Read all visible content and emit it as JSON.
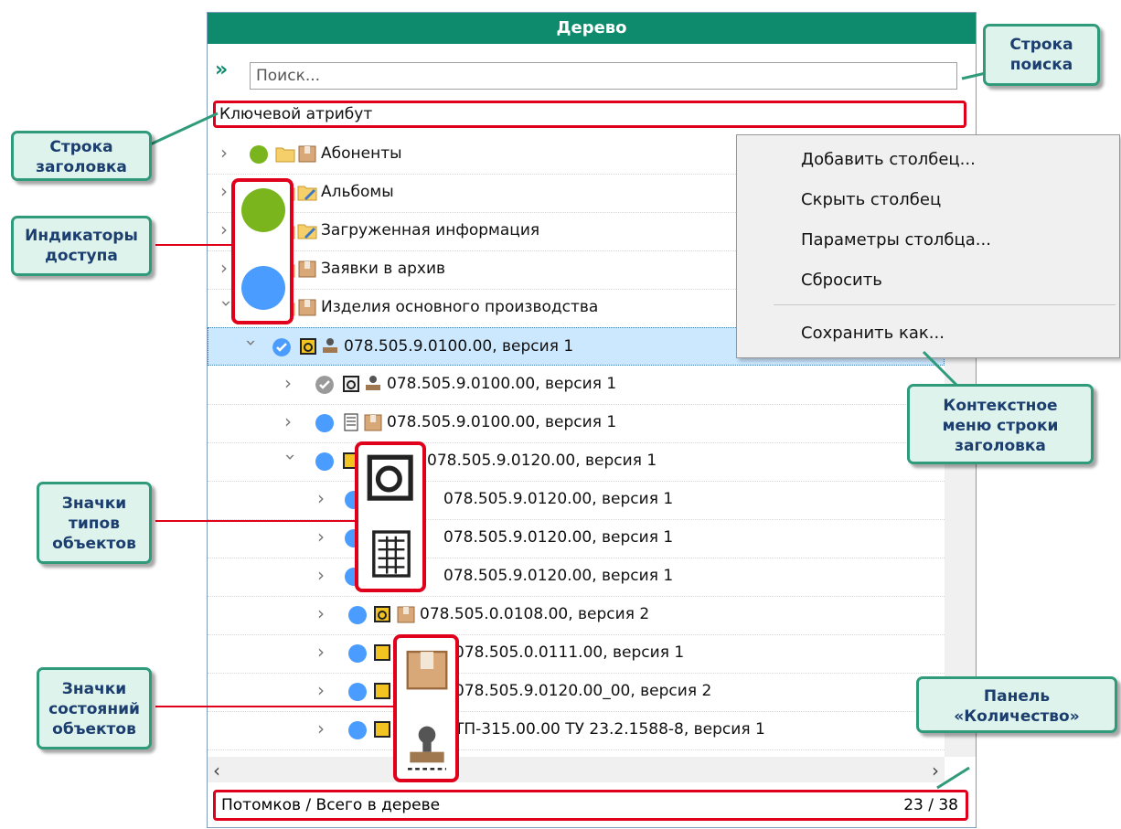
{
  "window": {
    "title": "Дерево"
  },
  "search": {
    "placeholder": "Поиск..."
  },
  "header_row": {
    "label": "Ключевой атрибут"
  },
  "tree": {
    "rows": [
      {
        "label": "Абоненты"
      },
      {
        "label": "Альбомы"
      },
      {
        "label": "Загруженная информация"
      },
      {
        "label": "Заявки в архив"
      },
      {
        "label": "Изделия основного производства"
      },
      {
        "label": "078.505.9.0100.00, версия 1"
      },
      {
        "label": "078.505.9.0100.00, версия 1"
      },
      {
        "label": "078.505.9.0100.00, версия 1"
      },
      {
        "label": "078.505.9.0120.00, версия 1"
      },
      {
        "label": "078.505.9.0120.00, версия 1"
      },
      {
        "label": "078.505.9.0120.00, версия 1"
      },
      {
        "label": "078.505.9.0120.00, версия 1"
      },
      {
        "label": "078.505.0.0108.00, версия 2"
      },
      {
        "label": "078.505.0.0111.00, версия 1"
      },
      {
        "label": "078.505.9.0120.00_00, версия 2"
      },
      {
        "label": "ТП-315.00.00 ТУ 23.2.1588-8, версия 1"
      }
    ]
  },
  "status": {
    "label": "Потомков / Всего в дереве",
    "count": "23 / 38"
  },
  "context_menu": {
    "items": [
      "Добавить столбец...",
      "Скрыть столбец",
      "Параметры столбца...",
      "Сбросить",
      "Сохранить как..."
    ]
  },
  "callouts": {
    "search_line1": "Строка",
    "search_line2": "поиска",
    "header_line1": "Строка",
    "header_line2": "заголовка",
    "access_line1": "Индикаторы",
    "access_line2": "доступа",
    "types_line1": "Значки",
    "types_line2": "типов",
    "types_line3": "объектов",
    "states_line1": "Значки",
    "states_line2": "состояний",
    "states_line3": "объектов",
    "ctx_line1": "Контекстное",
    "ctx_line2": "меню строки",
    "ctx_line3": "заголовка",
    "count_line1": "Панель",
    "count_line2": "«Количество»"
  },
  "colors": {
    "accent": "#0e8a6c",
    "highlight": "#e0001b",
    "access_green": "#7ab51d",
    "access_blue": "#4b9cff",
    "callout_bg": "#ddf3ec",
    "callout_text": "#1c3e6f"
  },
  "icons": {
    "search_expand": "double-chevron-right-icon",
    "folder": "folder-icon",
    "box_state": "box-icon",
    "stamp_state": "stamp-icon",
    "part_type": "part-icon",
    "document_type": "document-icon",
    "check": "check-circle-icon"
  }
}
